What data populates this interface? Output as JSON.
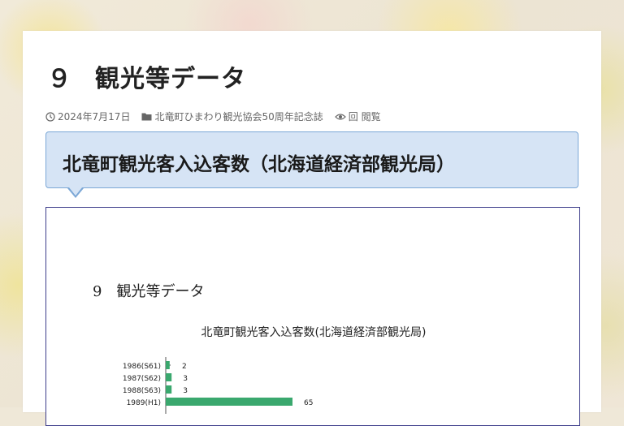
{
  "post": {
    "title_num": "９",
    "title_text": "観光等データ",
    "date": "2024年7月17日",
    "category": "北竜町ひまわり観光協会50周年記念誌",
    "views_count": "回",
    "views_label": "閲覧"
  },
  "heading": {
    "text": "北竜町観光客入込客数（北海道経済部観光局）"
  },
  "document": {
    "heading_num": "9",
    "heading_text": "観光等データ",
    "chart_title": "北竜町観光客入込客数(北海道経済部観光局)"
  },
  "colors": {
    "accent_border": "#7ba7d6",
    "heading_bg": "#d6e4f5",
    "bar": "#3aa86e",
    "frame": "#3c3c8a"
  },
  "icons": {
    "date": "clock-icon",
    "category": "folder-icon",
    "views": "eye-icon"
  },
  "chart_data": {
    "type": "bar",
    "orientation": "horizontal",
    "categories": [
      "1986(S61)",
      "1987(S62)",
      "1988(S63)",
      "1989(H1)"
    ],
    "values": [
      2,
      3,
      3,
      65
    ],
    "title": "北竜町観光客入込客数(北海道経済部観光局)",
    "xlabel": "",
    "ylabel": "",
    "xlim": [
      0,
      100
    ],
    "grid": false
  }
}
